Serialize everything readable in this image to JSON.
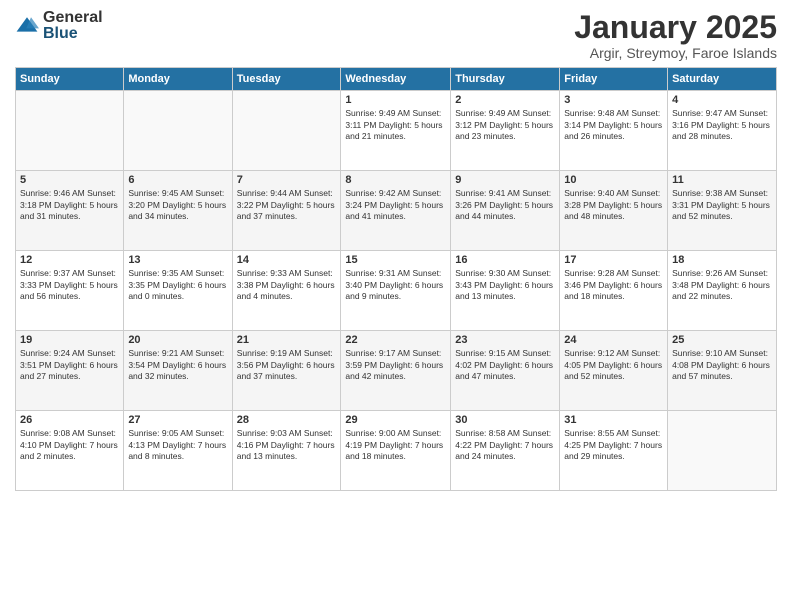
{
  "logo": {
    "general": "General",
    "blue": "Blue"
  },
  "header": {
    "month": "January 2025",
    "location": "Argir, Streymoy, Faroe Islands"
  },
  "weekdays": [
    "Sunday",
    "Monday",
    "Tuesday",
    "Wednesday",
    "Thursday",
    "Friday",
    "Saturday"
  ],
  "weeks": [
    [
      {
        "day": "",
        "info": ""
      },
      {
        "day": "",
        "info": ""
      },
      {
        "day": "",
        "info": ""
      },
      {
        "day": "1",
        "info": "Sunrise: 9:49 AM\nSunset: 3:11 PM\nDaylight: 5 hours and 21 minutes."
      },
      {
        "day": "2",
        "info": "Sunrise: 9:49 AM\nSunset: 3:12 PM\nDaylight: 5 hours and 23 minutes."
      },
      {
        "day": "3",
        "info": "Sunrise: 9:48 AM\nSunset: 3:14 PM\nDaylight: 5 hours and 26 minutes."
      },
      {
        "day": "4",
        "info": "Sunrise: 9:47 AM\nSunset: 3:16 PM\nDaylight: 5 hours and 28 minutes."
      }
    ],
    [
      {
        "day": "5",
        "info": "Sunrise: 9:46 AM\nSunset: 3:18 PM\nDaylight: 5 hours and 31 minutes."
      },
      {
        "day": "6",
        "info": "Sunrise: 9:45 AM\nSunset: 3:20 PM\nDaylight: 5 hours and 34 minutes."
      },
      {
        "day": "7",
        "info": "Sunrise: 9:44 AM\nSunset: 3:22 PM\nDaylight: 5 hours and 37 minutes."
      },
      {
        "day": "8",
        "info": "Sunrise: 9:42 AM\nSunset: 3:24 PM\nDaylight: 5 hours and 41 minutes."
      },
      {
        "day": "9",
        "info": "Sunrise: 9:41 AM\nSunset: 3:26 PM\nDaylight: 5 hours and 44 minutes."
      },
      {
        "day": "10",
        "info": "Sunrise: 9:40 AM\nSunset: 3:28 PM\nDaylight: 5 hours and 48 minutes."
      },
      {
        "day": "11",
        "info": "Sunrise: 9:38 AM\nSunset: 3:31 PM\nDaylight: 5 hours and 52 minutes."
      }
    ],
    [
      {
        "day": "12",
        "info": "Sunrise: 9:37 AM\nSunset: 3:33 PM\nDaylight: 5 hours and 56 minutes."
      },
      {
        "day": "13",
        "info": "Sunrise: 9:35 AM\nSunset: 3:35 PM\nDaylight: 6 hours and 0 minutes."
      },
      {
        "day": "14",
        "info": "Sunrise: 9:33 AM\nSunset: 3:38 PM\nDaylight: 6 hours and 4 minutes."
      },
      {
        "day": "15",
        "info": "Sunrise: 9:31 AM\nSunset: 3:40 PM\nDaylight: 6 hours and 9 minutes."
      },
      {
        "day": "16",
        "info": "Sunrise: 9:30 AM\nSunset: 3:43 PM\nDaylight: 6 hours and 13 minutes."
      },
      {
        "day": "17",
        "info": "Sunrise: 9:28 AM\nSunset: 3:46 PM\nDaylight: 6 hours and 18 minutes."
      },
      {
        "day": "18",
        "info": "Sunrise: 9:26 AM\nSunset: 3:48 PM\nDaylight: 6 hours and 22 minutes."
      }
    ],
    [
      {
        "day": "19",
        "info": "Sunrise: 9:24 AM\nSunset: 3:51 PM\nDaylight: 6 hours and 27 minutes."
      },
      {
        "day": "20",
        "info": "Sunrise: 9:21 AM\nSunset: 3:54 PM\nDaylight: 6 hours and 32 minutes."
      },
      {
        "day": "21",
        "info": "Sunrise: 9:19 AM\nSunset: 3:56 PM\nDaylight: 6 hours and 37 minutes."
      },
      {
        "day": "22",
        "info": "Sunrise: 9:17 AM\nSunset: 3:59 PM\nDaylight: 6 hours and 42 minutes."
      },
      {
        "day": "23",
        "info": "Sunrise: 9:15 AM\nSunset: 4:02 PM\nDaylight: 6 hours and 47 minutes."
      },
      {
        "day": "24",
        "info": "Sunrise: 9:12 AM\nSunset: 4:05 PM\nDaylight: 6 hours and 52 minutes."
      },
      {
        "day": "25",
        "info": "Sunrise: 9:10 AM\nSunset: 4:08 PM\nDaylight: 6 hours and 57 minutes."
      }
    ],
    [
      {
        "day": "26",
        "info": "Sunrise: 9:08 AM\nSunset: 4:10 PM\nDaylight: 7 hours and 2 minutes."
      },
      {
        "day": "27",
        "info": "Sunrise: 9:05 AM\nSunset: 4:13 PM\nDaylight: 7 hours and 8 minutes."
      },
      {
        "day": "28",
        "info": "Sunrise: 9:03 AM\nSunset: 4:16 PM\nDaylight: 7 hours and 13 minutes."
      },
      {
        "day": "29",
        "info": "Sunrise: 9:00 AM\nSunset: 4:19 PM\nDaylight: 7 hours and 18 minutes."
      },
      {
        "day": "30",
        "info": "Sunrise: 8:58 AM\nSunset: 4:22 PM\nDaylight: 7 hours and 24 minutes."
      },
      {
        "day": "31",
        "info": "Sunrise: 8:55 AM\nSunset: 4:25 PM\nDaylight: 7 hours and 29 minutes."
      },
      {
        "day": "",
        "info": ""
      }
    ]
  ]
}
